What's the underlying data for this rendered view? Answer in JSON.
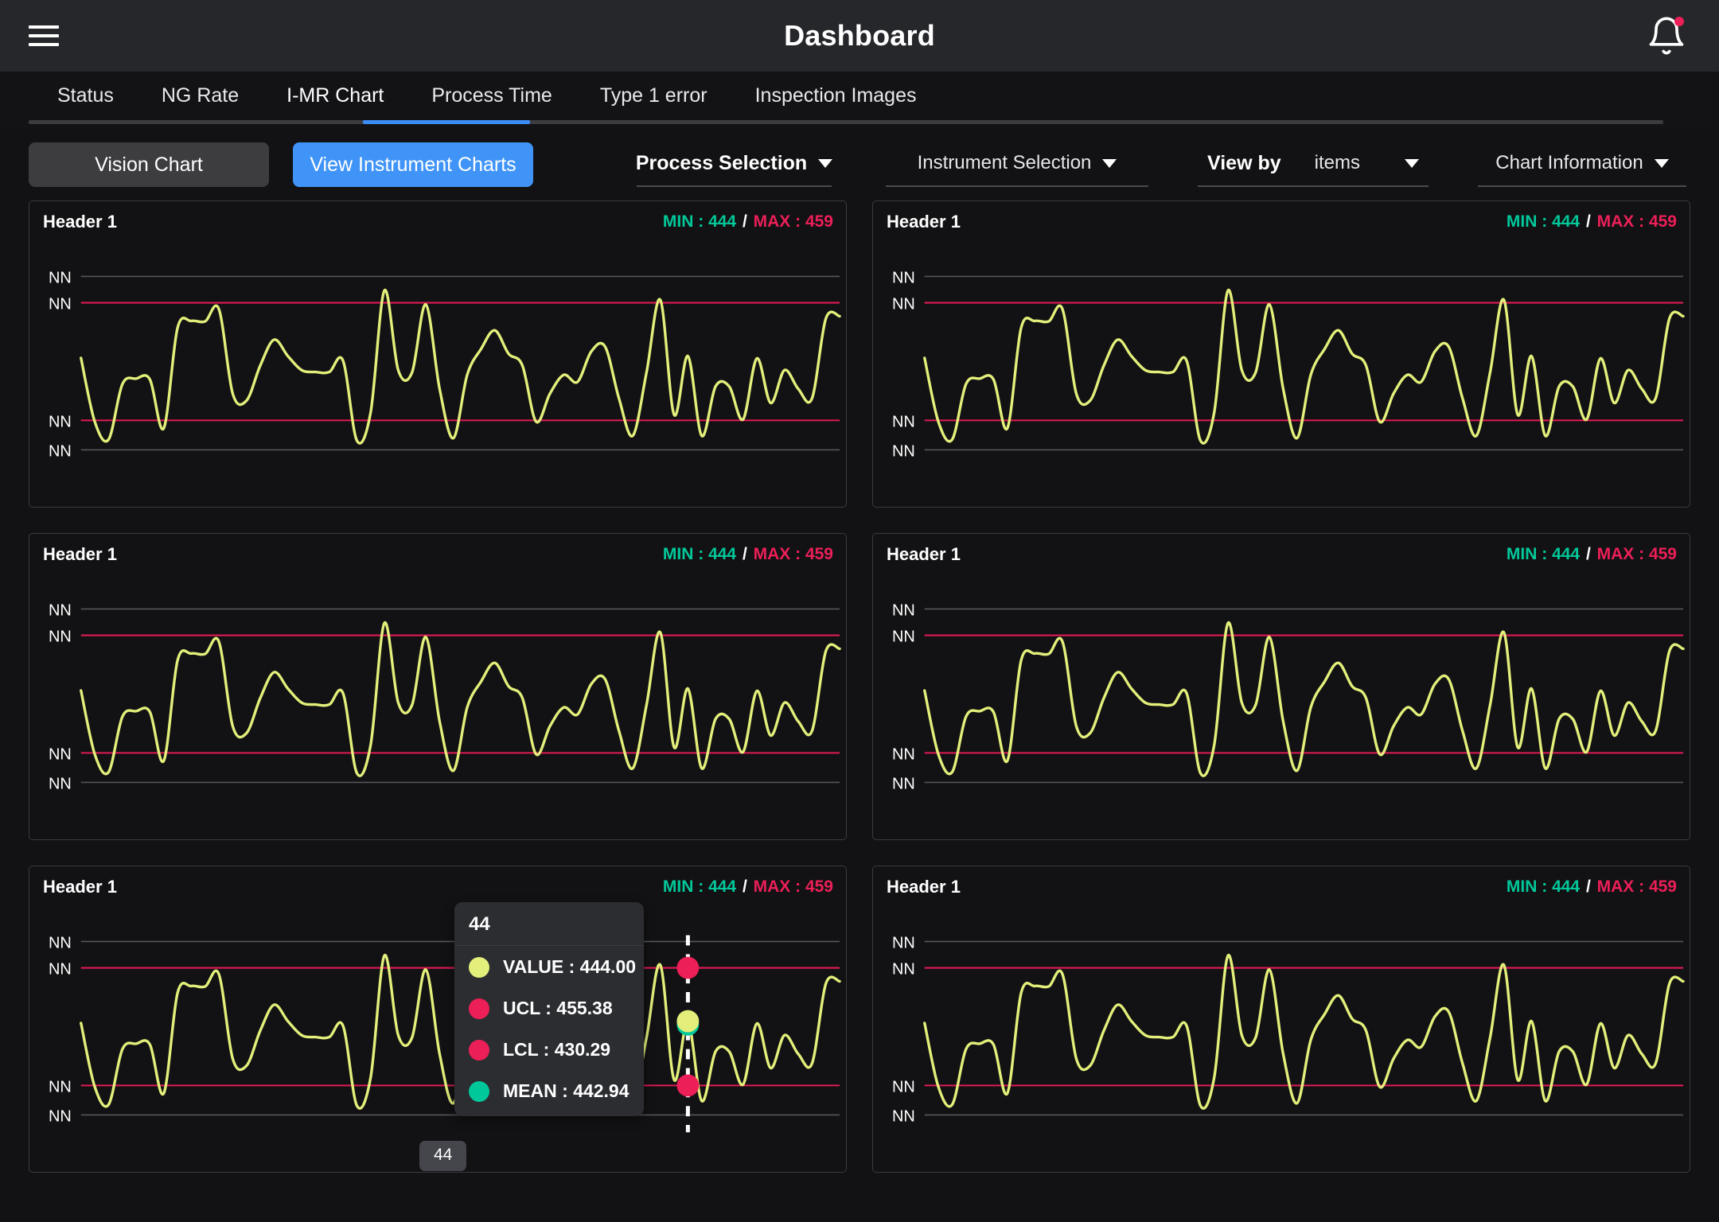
{
  "header": {
    "title": "Dashboard",
    "menu_icon": "hamburger-icon",
    "notification_icon": "bell-icon",
    "has_notification": true
  },
  "tabs": [
    {
      "label": "Status",
      "active": false
    },
    {
      "label": "NG Rate",
      "active": false
    },
    {
      "label": "I-MR Chart",
      "active": true
    },
    {
      "label": "Process Time",
      "active": false
    },
    {
      "label": "Type 1 error",
      "active": false
    },
    {
      "label": "Inspection Images",
      "active": false
    }
  ],
  "toolbar": {
    "vision_chart_label": "Vision Chart",
    "view_instrument_charts_label": "View Instrument Charts",
    "process_selection_label": "Process Selection",
    "instrument_selection_label": "Instrument Selection",
    "view_by_label": "View by",
    "view_by_value": "items",
    "chart_information_label": "Chart Information"
  },
  "colors": {
    "accent_blue": "#4094f7",
    "series_yellow": "#e3ef7a",
    "control_limit": "#e01a54",
    "mean_green": "#00c89a",
    "min_text": "#00c89a",
    "max_text": "#ec1f58",
    "grid_line": "#55565b",
    "card_border": "#3a3a3e",
    "page_bg": "#121214",
    "topbar_bg": "#26272b"
  },
  "cards": [
    {
      "title": "Header 1",
      "min_label": "MIN : ",
      "min_value": "444",
      "separator": " / ",
      "max_label": "MAX : ",
      "max_value": "459",
      "axis_labels": [
        "NN",
        "NN",
        "NN",
        "NN"
      ]
    },
    {
      "title": "Header 1",
      "min_label": "MIN : ",
      "min_value": "444",
      "separator": " / ",
      "max_label": "MAX : ",
      "max_value": "459",
      "axis_labels": [
        "NN",
        "NN",
        "NN",
        "NN"
      ]
    },
    {
      "title": "Header 1",
      "min_label": "MIN : ",
      "min_value": "444",
      "separator": " / ",
      "max_label": "MAX : ",
      "max_value": "459",
      "axis_labels": [
        "NN",
        "NN",
        "NN",
        "NN"
      ]
    },
    {
      "title": "Header 1",
      "min_label": "MIN : ",
      "min_value": "444",
      "separator": " / ",
      "max_label": "MAX : ",
      "max_value": "459",
      "axis_labels": [
        "NN",
        "NN",
        "NN",
        "NN"
      ]
    },
    {
      "title": "Header 1",
      "min_label": "MIN : ",
      "min_value": "444",
      "separator": " / ",
      "max_label": "MAX : ",
      "max_value": "459",
      "axis_labels": [
        "NN",
        "NN",
        "NN",
        "NN"
      ]
    },
    {
      "title": "Header 1",
      "min_label": "MIN : ",
      "min_value": "444",
      "separator": " / ",
      "max_label": "MAX : ",
      "max_value": "459",
      "axis_labels": [
        "NN",
        "NN",
        "NN",
        "NN"
      ]
    }
  ],
  "tooltip": {
    "x_label": "44",
    "rows": [
      {
        "label": "VALUE : 444.00",
        "color": "#e3ef7a"
      },
      {
        "label": "UCL : 455.38",
        "color": "#ec1f58"
      },
      {
        "label": "LCL : 430.29",
        "color": "#ec1f58"
      },
      {
        "label": "MEAN : 442.94",
        "color": "#00c89a"
      }
    ],
    "x_axis_badge": "44"
  },
  "chart_data": {
    "type": "line",
    "title": "Header 1",
    "xlabel": "",
    "ylabel": "",
    "ylim": [
      424,
      465
    ],
    "grid": true,
    "legend": false,
    "annotations": {
      "ucl": 455.38,
      "lcl": 430.29,
      "mean": 442.94,
      "min": 444,
      "max": 459,
      "highlighted_point_index": 44,
      "highlighted_point_value": 444.0
    },
    "axis_tick_labels": [
      "NN",
      "NN",
      "NN",
      "NN"
    ],
    "gridline_values": [
      461.0,
      455.38,
      430.29,
      424.0
    ],
    "series": [
      {
        "name": "VALUE",
        "color": "#e3ef7a",
        "x": [
          0,
          1,
          2,
          3,
          4,
          5,
          6,
          7,
          8,
          9,
          10,
          11,
          12,
          13,
          14,
          15,
          16,
          17,
          18,
          19,
          20,
          21,
          22,
          23,
          24,
          25,
          26,
          27,
          28,
          29,
          30,
          31,
          32,
          33,
          34,
          35,
          36,
          37,
          38,
          39,
          40,
          41,
          42,
          43,
          44,
          45,
          46,
          47,
          48,
          49,
          50,
          51,
          52,
          53,
          54,
          55
        ],
        "values": [
          443.6,
          430.0,
          426.2,
          438.0,
          439.2,
          439.0,
          428.6,
          450.0,
          451.5,
          451.4,
          454.0,
          436.0,
          434.5,
          442.0,
          447.5,
          444.0,
          441.0,
          440.6,
          440.6,
          443.0,
          426.0,
          432.0,
          458.0,
          441.0,
          440.5,
          455.0,
          437.0,
          426.5,
          440.0,
          445.5,
          449.5,
          444.5,
          442.0,
          430.0,
          436.0,
          440.0,
          438.5,
          445.0,
          446.0,
          435.0,
          427.0,
          440.5,
          456.0,
          431.5,
          444.0,
          427.0,
          437.5,
          437.5,
          430.5,
          443.5,
          434.0,
          441.0,
          437.0,
          435.0,
          452.0,
          452.5
        ]
      },
      {
        "name": "UCL",
        "color": "#e01a54",
        "constant": 455.38
      },
      {
        "name": "LCL",
        "color": "#e01a54",
        "constant": 430.29
      }
    ]
  }
}
